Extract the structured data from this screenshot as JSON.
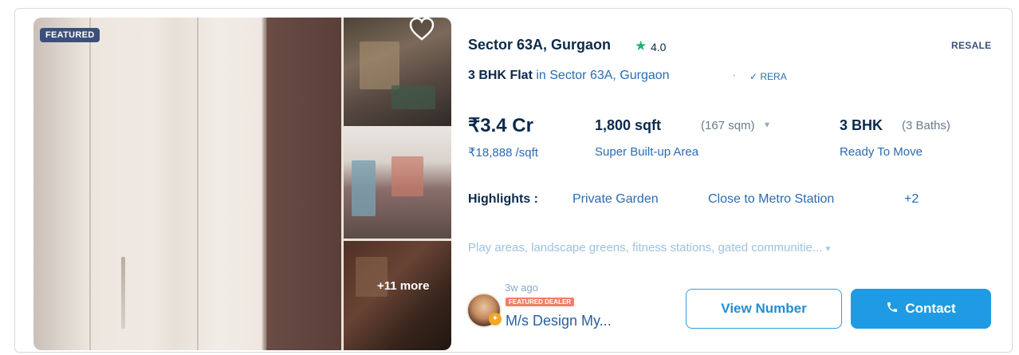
{
  "listing": {
    "featured_badge": "FEATURED",
    "title": "Sector 63A, Gurgaon",
    "rating": "4.0",
    "listing_type": "RESALE",
    "subtitle_bold": "3 BHK Flat",
    "subtitle_rest": " in Sector 63A, Gurgaon",
    "separator": "·",
    "rera": "✓ RERA",
    "more_photos": "+11 more"
  },
  "price": {
    "total": "₹3.4 Cr",
    "per_sqft": "₹18,888 /sqft"
  },
  "area": {
    "value": "1,800 sqft",
    "sqm": "(167 sqm)",
    "label": "Super Built-up Area"
  },
  "config": {
    "bhk": "3 BHK",
    "baths": "(3 Baths)",
    "status": "Ready To Move"
  },
  "highlights": {
    "title": "Highlights :",
    "items": [
      "Private Garden",
      "Close to Metro Station",
      "+2"
    ]
  },
  "description": "Play areas, landscape greens, fitness stations, gated communitie... ",
  "dealer": {
    "posted": "3w ago",
    "badge": "FEATURED DEALER",
    "name": "M/s Design My..."
  },
  "actions": {
    "view_number": "View Number",
    "contact": "Contact"
  },
  "colors": {
    "primary_blue": "#1e9be4",
    "rating_green": "#22b07a",
    "dealer_badge": "#f27e6b"
  }
}
